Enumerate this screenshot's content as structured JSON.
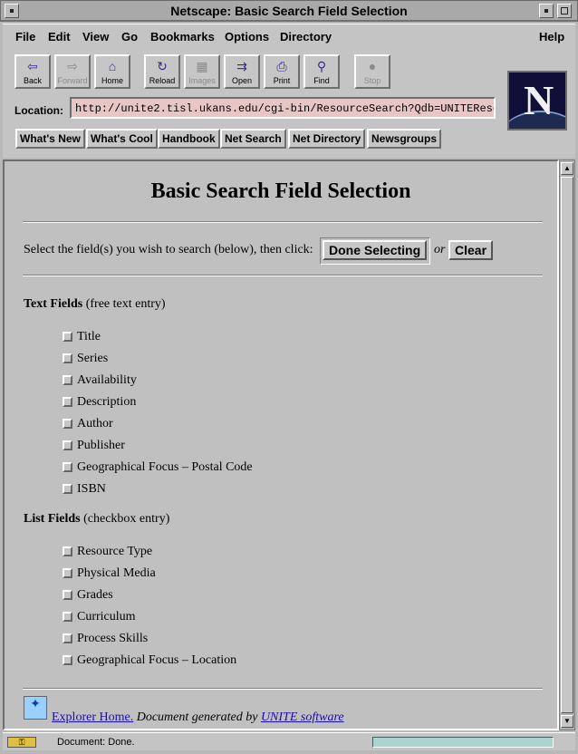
{
  "window": {
    "title": "Netscape: Basic Search Field Selection"
  },
  "menu": [
    {
      "label": "File"
    },
    {
      "label": "Edit"
    },
    {
      "label": "View"
    },
    {
      "label": "Go"
    },
    {
      "label": "Bookmarks"
    },
    {
      "label": "Options"
    },
    {
      "label": "Directory"
    },
    {
      "label": "Help"
    }
  ],
  "toolbar": [
    {
      "label": "Back",
      "icon": "back-arrow-icon"
    },
    {
      "label": "Forward",
      "icon": "forward-arrow-icon",
      "disabled": true
    },
    {
      "label": "Home",
      "icon": "home-icon"
    },
    {
      "label": "Reload",
      "icon": "reload-icon"
    },
    {
      "label": "Images",
      "icon": "images-icon",
      "disabled": true
    },
    {
      "label": "Open",
      "icon": "open-icon"
    },
    {
      "label": "Print",
      "icon": "print-icon"
    },
    {
      "label": "Find",
      "icon": "find-icon"
    },
    {
      "label": "Stop",
      "icon": "stop-icon",
      "disabled": true
    }
  ],
  "location": {
    "label": "Location:",
    "url": "http://unite2.tisl.ukans.edu/cgi-bin/ResourceSearch?Qdb=UNITEReso"
  },
  "directory_buttons": [
    {
      "label": "What's New"
    },
    {
      "label": "What's Cool"
    },
    {
      "label": "Handbook"
    },
    {
      "label": "Net Search"
    },
    {
      "label": "Net Directory"
    },
    {
      "label": "Newsgroups"
    }
  ],
  "page": {
    "title": "Basic Search Field Selection",
    "instruction": "Select the field(s) you wish to search (below), then click:",
    "done_button": "Done Selecting",
    "or_text": "or",
    "clear_button": "Clear",
    "text_fields_heading": "Text Fields",
    "text_fields_note": "(free text entry)",
    "text_fields": [
      {
        "label": "Title"
      },
      {
        "label": "Series"
      },
      {
        "label": "Availability"
      },
      {
        "label": "Description"
      },
      {
        "label": "Author"
      },
      {
        "label": "Publisher"
      },
      {
        "label": "Geographical Focus – Postal Code"
      },
      {
        "label": "ISBN"
      }
    ],
    "list_fields_heading": "List Fields",
    "list_fields_note": "(checkbox entry)",
    "list_fields": [
      {
        "label": "Resource Type"
      },
      {
        "label": "Physical Media"
      },
      {
        "label": "Grades"
      },
      {
        "label": "Curriculum"
      },
      {
        "label": "Process Skills"
      },
      {
        "label": "Geographical Focus – Location"
      }
    ],
    "footer": {
      "home_link": "Explorer Home.",
      "generated_text": "Document generated by",
      "unite_link": "UNITE software"
    }
  },
  "status": {
    "text": "Document: Done.",
    "progress": 1.0
  },
  "colors": {
    "chrome": "#c4c4c4",
    "location_bg": "#e8c6c6",
    "link": "#1a0dab"
  }
}
